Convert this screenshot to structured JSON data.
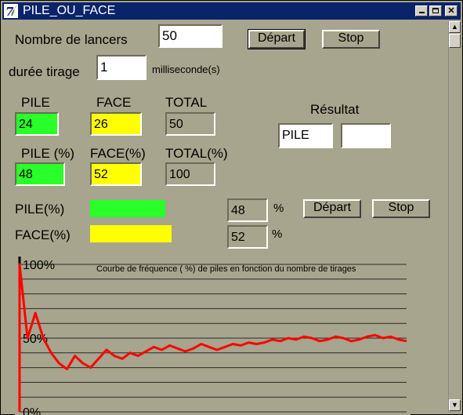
{
  "window": {
    "title": "PILE_OU_FACE"
  },
  "controls": {
    "nombre_label": "Nombre de lancers",
    "nombre_value": "50",
    "depart_label": "Départ",
    "stop_label": "Stop",
    "duree_label": "durée tirage",
    "duree_value": "1",
    "duree_unit": "milliseconde(s)"
  },
  "stats": {
    "pile_label": "PILE",
    "face_label": "FACE",
    "total_label": "TOTAL",
    "pile_value": "24",
    "face_value": "26",
    "total_value": "50",
    "pile_pct_label": "PILE (%)",
    "face_pct_label": "FACE(%)",
    "total_pct_label": "TOTAL(%)",
    "pile_pct_value": "48",
    "face_pct_value": "52",
    "total_pct_value": "100",
    "resultat_label": "Résultat",
    "resultat_value": "PILE",
    "resultat_value2": ""
  },
  "bars": {
    "pile_label": "PILE(%)",
    "face_label": "FACE(%)",
    "pile_fraction": 0.48,
    "face_fraction": 0.52,
    "pile_value": "48",
    "face_value": "52",
    "pct_symbol": "%",
    "depart_label": "Départ",
    "stop_label": "Stop",
    "pile_color": "#29ff29",
    "face_color": "#ffff00"
  },
  "chart_data": {
    "type": "line",
    "title": "Courbe de fréquence ( %) de piles en fonction du nombre de tirages",
    "y_tick_labels": [
      "100%",
      "50%",
      "0%"
    ],
    "ylim": [
      0,
      100
    ],
    "xlim": [
      1,
      50
    ],
    "grid": true,
    "line_color": "#ff0000",
    "x": [
      1,
      2,
      3,
      4,
      5,
      6,
      7,
      8,
      9,
      10,
      11,
      12,
      13,
      14,
      15,
      16,
      17,
      18,
      19,
      20,
      21,
      22,
      23,
      24,
      25,
      26,
      27,
      28,
      29,
      30,
      31,
      32,
      33,
      34,
      35,
      36,
      37,
      38,
      39,
      40,
      41,
      42,
      43,
      44,
      45,
      46,
      47,
      48,
      49,
      50
    ],
    "values": [
      100,
      50,
      67,
      50,
      40,
      33,
      29,
      38,
      33,
      30,
      36,
      42,
      38,
      36,
      40,
      38,
      41,
      44,
      42,
      45,
      43,
      41,
      43,
      46,
      44,
      42,
      44,
      46,
      45,
      47,
      46,
      47,
      49,
      48,
      50,
      49,
      51,
      50,
      48,
      49,
      51,
      50,
      48,
      49,
      51,
      52,
      50,
      51,
      49,
      48
    ]
  }
}
